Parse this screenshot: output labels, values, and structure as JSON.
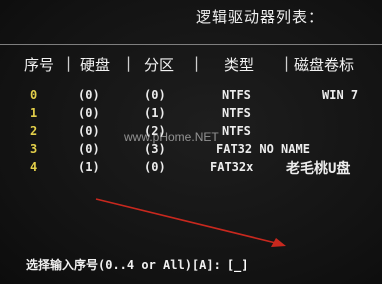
{
  "title": "逻辑驱动器列表：",
  "columns": [
    "序号",
    "硬盘",
    "分区",
    "类型",
    "磁盘卷标"
  ],
  "rows": [
    {
      "index": "0",
      "disk": "(0)",
      "partition": "(0)",
      "type": "NTFS",
      "label": "WIN 7"
    },
    {
      "index": "1",
      "disk": "(0)",
      "partition": "(1)",
      "type": "NTFS",
      "label": ""
    },
    {
      "index": "2",
      "disk": "(0)",
      "partition": "(2)",
      "type": "NTFS",
      "label": ""
    },
    {
      "index": "3",
      "disk": "(0)",
      "partition": "(3)",
      "type": "FAT32 NO NAME",
      "label": ""
    },
    {
      "index": "4",
      "disk": "(1)",
      "partition": "(0)",
      "type": "FAT32x",
      "label": "老毛桃U盘"
    }
  ],
  "prompt": "选择输入序号(0..4 or All)[A]:",
  "input_value": "[_]",
  "watermark": "www.pHome.NET",
  "colors": {
    "background": "#141414",
    "index_color": "#e3cf4a",
    "arrow": "#c8281e"
  },
  "icons": {
    "arrow": "red-arrow-icon"
  }
}
